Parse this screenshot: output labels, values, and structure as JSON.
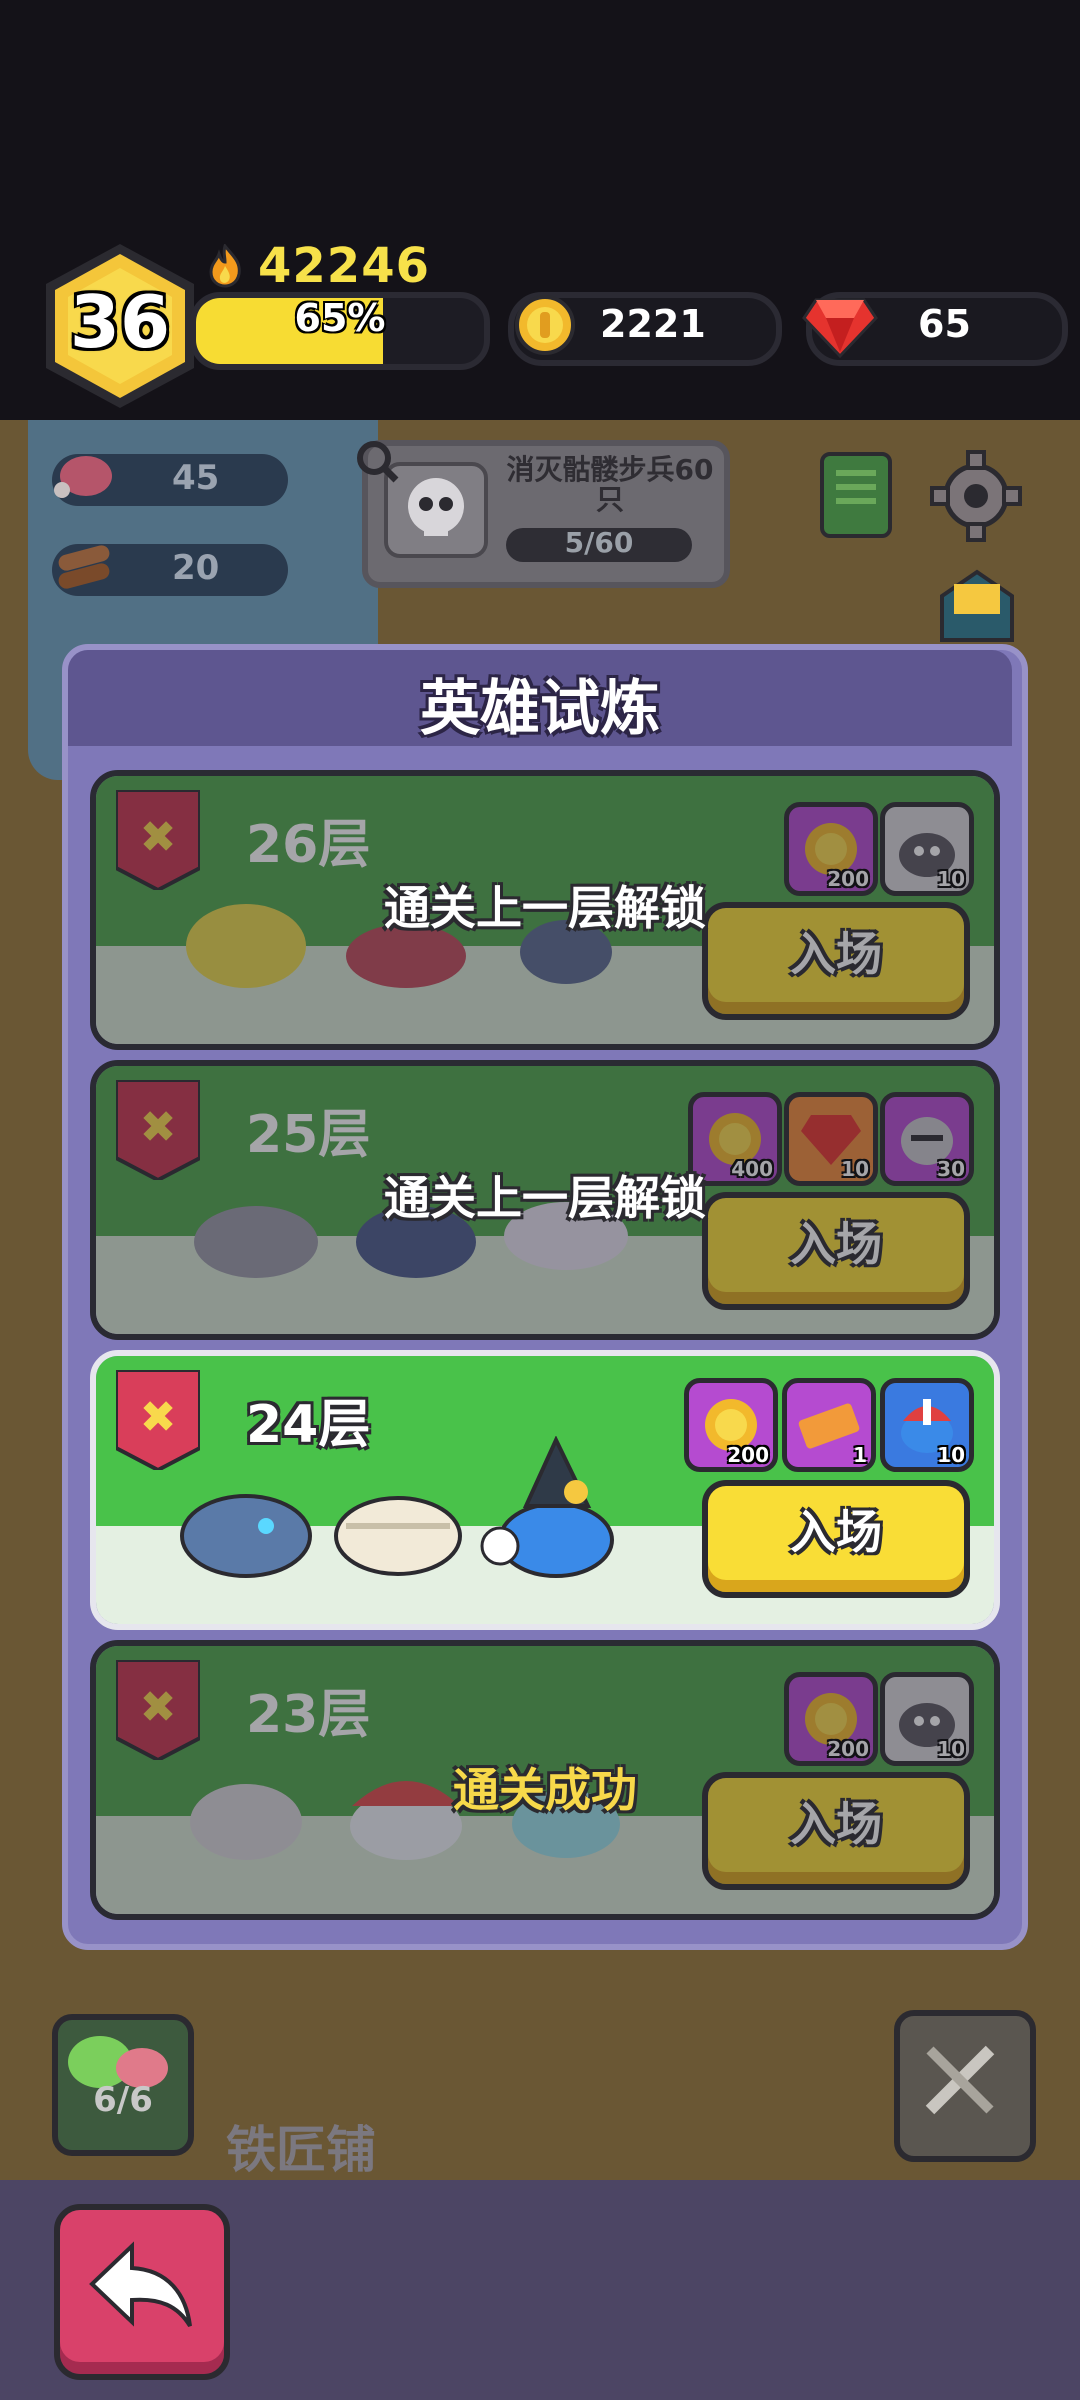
{
  "player": {
    "level": "36",
    "power": "42246",
    "xp_percent_label": "65%",
    "xp_fraction": 0.65
  },
  "currency": {
    "gold": "2221",
    "gems": "65"
  },
  "resources": {
    "meat": "45",
    "wood": "20"
  },
  "quest": {
    "title": "消灭骷髅步兵60只",
    "progress": "5/60"
  },
  "modal": {
    "title": "英雄试炼",
    "floors": [
      {
        "floor": "26层",
        "status": "locked",
        "overlay": "通关上一层解锁",
        "enter_label": "入场",
        "rewards": [
          {
            "icon": "gold-coin-icon",
            "qty": "200"
          },
          {
            "icon": "hero-slime-icon",
            "qty": "10"
          }
        ]
      },
      {
        "floor": "25层",
        "status": "locked",
        "overlay": "通关上一层解锁",
        "enter_label": "入场",
        "rewards": [
          {
            "icon": "gold-coin-icon",
            "qty": "400"
          },
          {
            "icon": "red-gem-icon",
            "qty": "10"
          },
          {
            "icon": "knight-helmet-icon",
            "qty": "30"
          }
        ]
      },
      {
        "floor": "24层",
        "status": "available",
        "overlay": "",
        "enter_label": "入场",
        "rewards": [
          {
            "icon": "gold-coin-icon",
            "qty": "200"
          },
          {
            "icon": "ticket-icon",
            "qty": "1"
          },
          {
            "icon": "hero-slime-icon",
            "qty": "10"
          }
        ]
      },
      {
        "floor": "23层",
        "status": "cleared",
        "overlay": "通关成功",
        "enter_label": "入场",
        "rewards": [
          {
            "icon": "gold-coin-icon",
            "qty": "200"
          },
          {
            "icon": "hero-slime-icon",
            "qty": "10"
          }
        ]
      }
    ]
  },
  "bottom": {
    "team_count": "6/6",
    "smithy_label": "铁匠铺"
  },
  "colors": {
    "accent_yellow": "#f9dd36",
    "modal_purple": "#7f78b8",
    "back_button": "#d9416a",
    "cleared_text": "#f7d94a"
  }
}
